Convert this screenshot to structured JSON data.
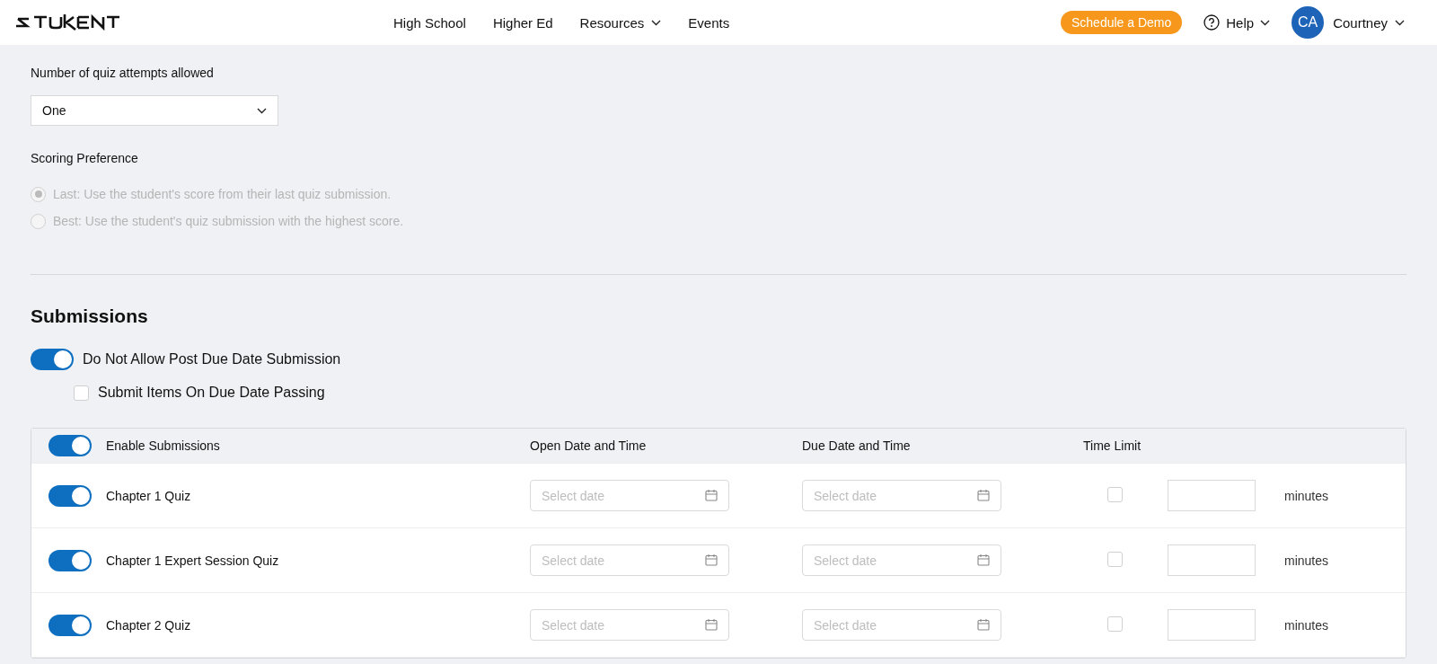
{
  "nav": {
    "links": [
      {
        "label": "High School",
        "dropdown": false
      },
      {
        "label": "Higher Ed",
        "dropdown": false
      },
      {
        "label": "Resources",
        "dropdown": true
      },
      {
        "label": "Events",
        "dropdown": false
      }
    ],
    "demo_button": "Schedule a Demo",
    "help": "Help",
    "user": {
      "initials": "CA",
      "name": "Courtney"
    }
  },
  "attempts": {
    "label": "Number of quiz attempts allowed",
    "value": "One"
  },
  "scoring": {
    "label": "Scoring Preference",
    "disabled": true,
    "options": [
      {
        "label": "Last: Use the student's score from their last quiz submission.",
        "selected": true
      },
      {
        "label": "Best: Use the student's quiz submission with the highest score.",
        "selected": false
      }
    ]
  },
  "submissions": {
    "title": "Submissions",
    "post_due": {
      "label": "Do Not Allow Post Due Date Submission",
      "on": true
    },
    "submit_on_due": {
      "label": "Submit Items On Due Date Passing",
      "checked": false
    }
  },
  "table": {
    "header": {
      "label": "Enable Submissions",
      "on": true
    },
    "columns": [
      "Open Date and Time",
      "Due Date and Time",
      "Time Limit"
    ],
    "rows": [
      {
        "name": "Chapter 1 Quiz",
        "on": true,
        "open_placeholder": "Select date",
        "due_placeholder": "Select date",
        "time_limit_checked": false,
        "unit": "minutes"
      },
      {
        "name": "Chapter 1 Expert Session Quiz",
        "on": true,
        "open_placeholder": "Select date",
        "due_placeholder": "Select date",
        "time_limit_checked": false,
        "unit": "minutes"
      },
      {
        "name": "Chapter 2 Quiz",
        "on": true,
        "open_placeholder": "Select date",
        "due_placeholder": "Select date",
        "time_limit_checked": false,
        "unit": "minutes"
      }
    ]
  }
}
